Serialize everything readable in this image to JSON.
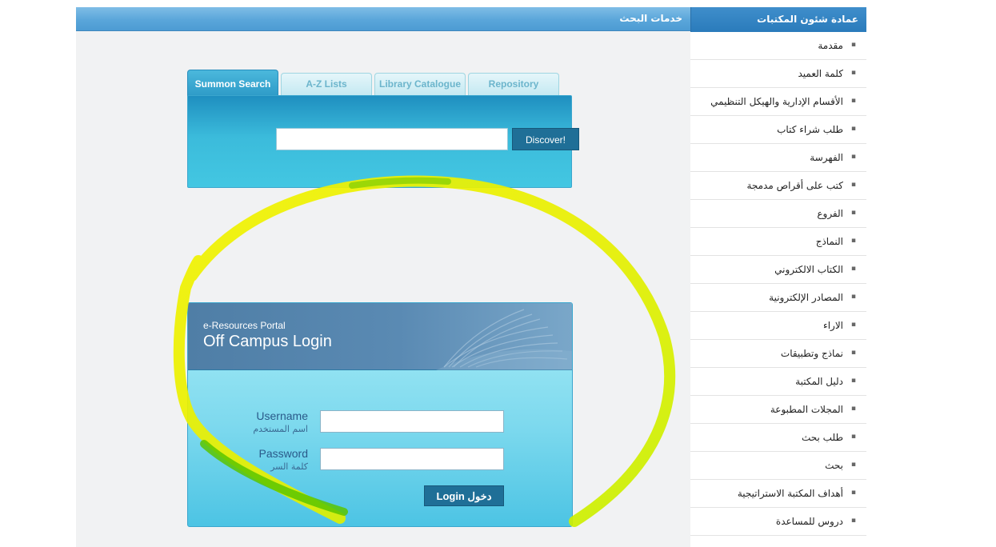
{
  "main": {
    "header_title": "خدمات البحث",
    "tabs": [
      {
        "label": "Summon Search",
        "active": true
      },
      {
        "label": "A-Z Lists",
        "active": false
      },
      {
        "label": "Library Catalogue",
        "active": false
      },
      {
        "label": "Repository",
        "active": false
      }
    ],
    "search": {
      "input_value": "",
      "discover_label": "Discover!"
    },
    "login": {
      "subtitle": "e-Resources Portal",
      "title": "Off Campus Login",
      "username_label": "Username",
      "username_label_ar": "اسم المستخدم",
      "password_label": "Password",
      "password_label_ar": "كلمة السر",
      "username_value": "",
      "password_value": "",
      "button_label": "Login دخول"
    }
  },
  "sidebar": {
    "title": "عمادة شئون المكتبات",
    "items": [
      {
        "label": "مقدمة"
      },
      {
        "label": "كلمة العميد"
      },
      {
        "label": "الأقسام الإدارية والهيكل التنظيمي"
      },
      {
        "label": "طلب شراء كتاب"
      },
      {
        "label": "الفهرسة"
      },
      {
        "label": "كتب على أقراص مدمجة"
      },
      {
        "label": "الفروع"
      },
      {
        "label": "النماذج"
      },
      {
        "label": "الكتاب الالكتروني"
      },
      {
        "label": "المصادر الإلكترونية"
      },
      {
        "label": "الاراء"
      },
      {
        "label": "نماذج وتطبيقات"
      },
      {
        "label": "دليل المكتبة"
      },
      {
        "label": "المجلات المطبوعة"
      },
      {
        "label": "طلب بحث"
      },
      {
        "label": "بحث"
      },
      {
        "label": "أهداف المكتبة الاستراتيجية"
      },
      {
        "label": "دروس للمساعدة"
      }
    ]
  },
  "colors": {
    "header_blue": "#4d9bd3",
    "search_teal": "#3bbbdb",
    "button_blue": "#1f6f97",
    "annotation_yellow": "#f2f200"
  }
}
